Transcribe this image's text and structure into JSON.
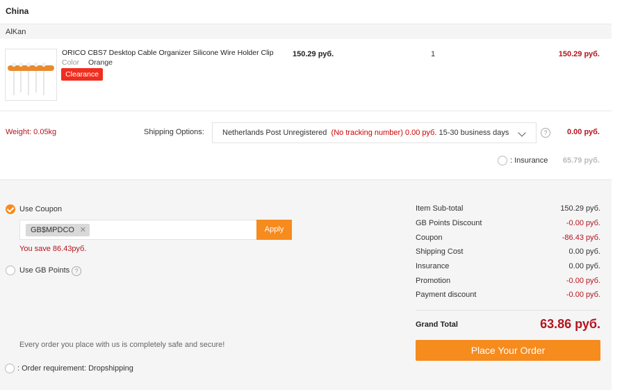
{
  "warehouse": {
    "country": "China"
  },
  "store": {
    "name": "AlKan"
  },
  "product": {
    "title": "ORICO CBS7 Desktop Cable Organizer Silicone Wire Holder Clip",
    "color_label": "Color",
    "color_value": "Orange",
    "badge": "Clearance",
    "unit_price": "150.29 руб.",
    "quantity": "1",
    "total": "150.29 руб."
  },
  "shipping": {
    "weight": "Weight: 0.05kg",
    "label": "Shipping Options:",
    "method": "Netherlands Post Unregistered",
    "tracking_note": "(No tracking number)",
    "method_cost": "0.00 руб.",
    "delivery_time": "15-30 business days",
    "cost": "0.00 руб.",
    "insurance_label": ": Insurance",
    "insurance_cost": "65.79 руб."
  },
  "coupon": {
    "use_label": "Use Coupon",
    "code": "GB$MPDCO",
    "apply_label": "Apply",
    "savings": "You save 86.43руб."
  },
  "points": {
    "use_label": "Use GB Points"
  },
  "footer": {
    "safe_text": "Every order you place with us is completely safe and secure!",
    "order_requirement": ": Order requirement: Dropshipping"
  },
  "summary": {
    "rows": [
      {
        "label": "Item Sub-total",
        "value": "150.29 руб."
      },
      {
        "label": "GB Points Discount",
        "value": "-0.00 руб."
      },
      {
        "label": "Coupon",
        "value": "-86.43 руб."
      },
      {
        "label": "Shipping Cost",
        "value": "0.00 руб."
      },
      {
        "label": "Insurance",
        "value": "0.00 руб."
      },
      {
        "label": "Promotion",
        "value": "-0.00 руб."
      },
      {
        "label": "Payment discount",
        "value": "-0.00 руб."
      }
    ],
    "grand_total_label": "Grand Total",
    "grand_total_value": "63.86 руб.",
    "place_order_label": "Place Your Order"
  },
  "colors": {
    "accent": "#f68b1e",
    "price": "#b4141e",
    "badge": "#f02d1f"
  }
}
